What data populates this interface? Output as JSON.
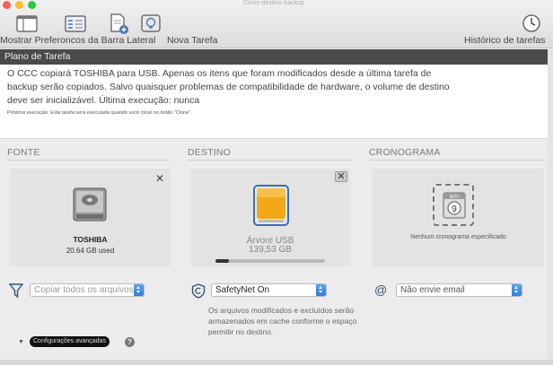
{
  "window": {
    "title": "Clone-destino-backup"
  },
  "toolbar": {
    "items": [
      {
        "label": "Mostrar Preferoncos da Barra Lateral"
      },
      {
        "label": "Nova Tarefa"
      },
      {
        "label": "Histórico de tarefas"
      }
    ]
  },
  "plan": {
    "header": "Plano de Tarefa",
    "text": "O CCC copiará TOSHIBA para USB. Apenas os itens que foram modificados desde a última tarefa de backup serão copiados. Salvo quaisquer problemas de compatibilidade de hardware, o volume de destino deve ser inicializável. Última execução: nunca",
    "next_run": "Próxima execução: Esta tarefa será executada quando você clicar no botão \"Clone\"."
  },
  "source": {
    "title": "FONTE",
    "disk_name": "TOSHIBA",
    "disk_size": "20.64 GB used",
    "filter_placeholder": "Copiar todos os arquivos"
  },
  "destination": {
    "title": "DESTINO",
    "disk_name": "Árvore USB",
    "disk_size": "139,53 GB",
    "usage_fraction": 0.12,
    "safetynet_value": "SafetyNet On",
    "safetynet_desc": "Os arquivos modificados e excluídos serão armazenados em cache conforme o espaço permitir no destino."
  },
  "schedule": {
    "title": "CRONOGRAMA",
    "calendar_month": "NOV",
    "calendar_day": "9",
    "empty_text": "Nenhum cronograma especificado",
    "email_value": "Não envie email"
  },
  "advanced": {
    "label": "Configurações avançadas",
    "help": "?"
  },
  "colors": {
    "accent": "#2f7de0",
    "header_bg": "#4a4a4a",
    "usb_drive": "#f4a717"
  }
}
